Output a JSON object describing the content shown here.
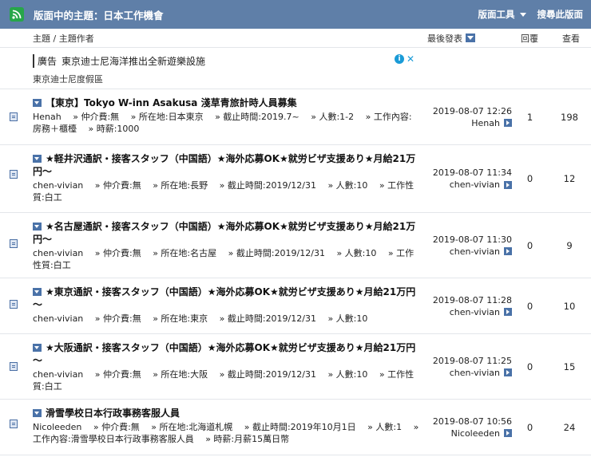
{
  "header": {
    "title": "版面中的主題：日本工作機會",
    "tools_label": "版面工具",
    "search_label": "搜尋此版面"
  },
  "columns": {
    "topic": "主題 / 主題作者",
    "last_post": "最後發表",
    "replies": "回覆",
    "views": "查看"
  },
  "ad": {
    "badge": "廣告",
    "title": "東京迪士尼海洋推出全新遊樂設施",
    "subtitle": "東京迪士尼度假區"
  },
  "threads": [
    {
      "title": "【東京】Tokyo W-inn Asakusa 淺草青旅計時人員募集",
      "meta": "Henah　 » 仲介費:無　 » 所在地:日本東京　 » 截止時間:2019.7~　 » 人數:1-2　 » 工作內容:房務＋櫃檯　 » 時薪:1000",
      "date": "2019-08-07 12:26",
      "last_user": "Henah",
      "replies": "1",
      "views": "198"
    },
    {
      "title": "★軽井沢通訳・接客スタッフ（中国語）★海外応募OK★就労ビザ支援あり★月給21万円～",
      "meta": "chen-vivian　 » 仲介費:無　 » 所在地:長野　 » 截止時間:2019/12/31　 » 人數:10　 » 工作性質:白工",
      "date": "2019-08-07 11:34",
      "last_user": "chen-vivian",
      "replies": "0",
      "views": "12"
    },
    {
      "title": "★名古屋通訳・接客スタッフ（中国語）★海外応募OK★就労ビザ支援あり★月給21万円～",
      "meta": "chen-vivian　 » 仲介費:無　 » 所在地:名古屋　 » 截止時間:2019/12/31　 » 人數:10　 » 工作性質:白工",
      "date": "2019-08-07 11:30",
      "last_user": "chen-vivian",
      "replies": "0",
      "views": "9"
    },
    {
      "title": "★東京通訳・接客スタッフ（中国語）★海外応募OK★就労ビザ支援あり★月給21万円～",
      "meta": "chen-vivian　 » 仲介費:無　 » 所在地:東京　 » 截止時間:2019/12/31　 » 人數:10",
      "date": "2019-08-07 11:28",
      "last_user": "chen-vivian",
      "replies": "0",
      "views": "10"
    },
    {
      "title": "★大阪通訳・接客スタッフ（中国語）★海外応募OK★就労ビザ支援あり★月給21万円～",
      "meta": "chen-vivian　 » 仲介費:無　 » 所在地:大阪　 » 截止時間:2019/12/31　 » 人數:10　 » 工作性質:白工",
      "date": "2019-08-07 11:25",
      "last_user": "chen-vivian",
      "replies": "0",
      "views": "15"
    },
    {
      "title": "滑雪學校日本行政事務客服人員",
      "meta": "Nicoleeden　 » 仲介費:無　 » 所在地:北海道札幌　 » 截止時間:2019年10月1日　 » 人數:1　 » 工作內容:滑雪學校日本行政事務客服人員　 » 時薪:月薪15萬日幣",
      "date": "2019-08-07 10:56",
      "last_user": "Nicoleeden",
      "replies": "0",
      "views": "24"
    }
  ]
}
